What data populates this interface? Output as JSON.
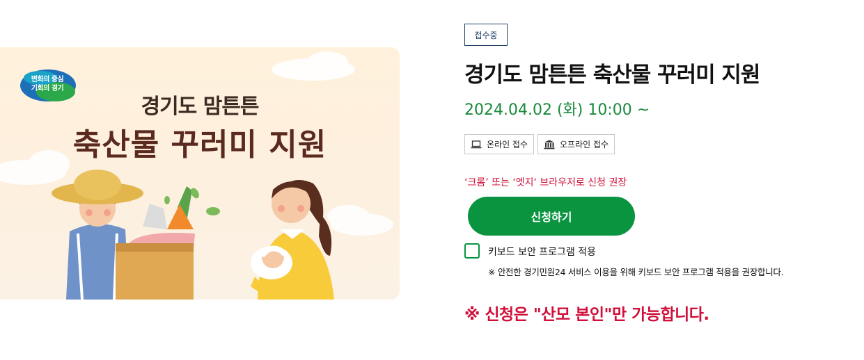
{
  "banner": {
    "logo_line1": "변화의 중심",
    "logo_line2": "기회의 경기",
    "subtitle": "경기도 맘튼튼",
    "title": "축산물 꾸러미 지원"
  },
  "status_badge": "접수중",
  "title": "경기도 맘튼튼 축산물 꾸러미 지원",
  "date": "2024.04.02 (화) 10:00 ~",
  "channels": [
    {
      "label": "온라인 접수",
      "icon": "laptop-icon"
    },
    {
      "label": "오프라인 접수",
      "icon": "building-icon"
    }
  ],
  "browser_note": "‘크롬’ 또는 ‘엣지‘ 브라우저로 신청 권장",
  "apply_button": "신청하기",
  "keyboard_security": {
    "label": "키보드 보안 프로그램 적용",
    "checked": false,
    "note": "※ 안전한 경기민원24 서비스 이용을 위해 키보드 보안 프로그램 적용을 권장합니다."
  },
  "eligibility_notice": "※ 신청은 \"산모 본인\"만 가능합니다.",
  "colors": {
    "accent_green": "#0a9440",
    "alert_red": "#d0103a",
    "badge_navy": "#1e3f66"
  }
}
